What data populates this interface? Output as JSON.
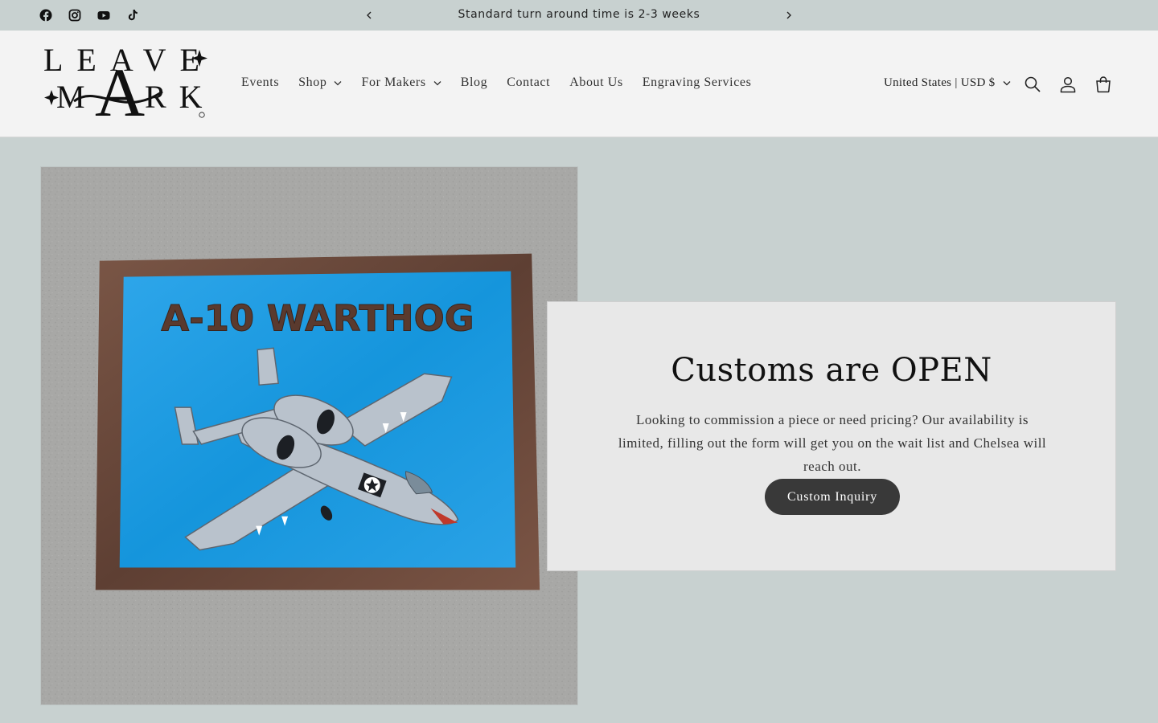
{
  "announcement": {
    "text": "Standard turn around time is 2-3 weeks",
    "social_icons": [
      "facebook-icon",
      "instagram-icon",
      "youtube-icon",
      "tiktok-icon"
    ]
  },
  "header": {
    "logo": {
      "line1": "LEAVE",
      "line2": "MARK"
    },
    "nav": [
      {
        "label": "Events",
        "dropdown": false
      },
      {
        "label": "Shop",
        "dropdown": true
      },
      {
        "label": "For Makers",
        "dropdown": true
      },
      {
        "label": "Blog",
        "dropdown": false
      },
      {
        "label": "Contact",
        "dropdown": false
      },
      {
        "label": "About Us",
        "dropdown": false
      },
      {
        "label": "Engraving Services",
        "dropdown": false
      }
    ],
    "currency": "United States | USD $",
    "icons": [
      "search-icon",
      "account-icon",
      "cart-icon"
    ]
  },
  "hero": {
    "image_text": "A-10 WARTHOG",
    "card": {
      "title": "Customs are OPEN",
      "text": "Looking to commission a piece or need pricing? Our availability is limited, filling out the form will get you on the wait list and Chelsea will reach out.",
      "button": "Custom Inquiry"
    }
  },
  "colors": {
    "page_bg": "#c8d1d0",
    "header_bg": "#f3f3f3",
    "card_bg": "#e8e8e8",
    "button_bg": "#393939",
    "art_blue": "#1a9be0",
    "frame_wood": "#6b4a3c"
  }
}
